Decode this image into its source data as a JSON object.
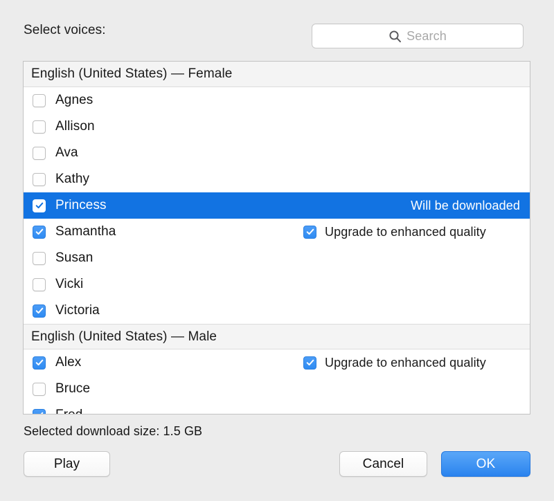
{
  "dialog": {
    "prompt_label": "Select voices:",
    "size_text": "Selected download size: 1.5 GB"
  },
  "search": {
    "icon": "search-icon",
    "placeholder": "Search",
    "value": ""
  },
  "groups": [
    {
      "header": "English (United States) — Female",
      "rows": [
        {
          "name": "Agnes",
          "checked": false,
          "selected": false,
          "status": "",
          "upgrade": null
        },
        {
          "name": "Allison",
          "checked": false,
          "selected": false,
          "status": "",
          "upgrade": null
        },
        {
          "name": "Ava",
          "checked": false,
          "selected": false,
          "status": "",
          "upgrade": null
        },
        {
          "name": "Kathy",
          "checked": false,
          "selected": false,
          "status": "",
          "upgrade": null
        },
        {
          "name": "Princess",
          "checked": true,
          "selected": true,
          "status": "Will be downloaded",
          "upgrade": null
        },
        {
          "name": "Samantha",
          "checked": true,
          "selected": false,
          "status": "",
          "upgrade": {
            "label": "Upgrade to enhanced quality",
            "checked": true
          }
        },
        {
          "name": "Susan",
          "checked": false,
          "selected": false,
          "status": "",
          "upgrade": null
        },
        {
          "name": "Vicki",
          "checked": false,
          "selected": false,
          "status": "",
          "upgrade": null
        },
        {
          "name": "Victoria",
          "checked": true,
          "selected": false,
          "status": "",
          "upgrade": null
        }
      ]
    },
    {
      "header": "English (United States) — Male",
      "rows": [
        {
          "name": "Alex",
          "checked": true,
          "selected": false,
          "status": "",
          "upgrade": {
            "label": "Upgrade to enhanced quality",
            "checked": true
          }
        },
        {
          "name": "Bruce",
          "checked": false,
          "selected": false,
          "status": "",
          "upgrade": null
        },
        {
          "name": "Fred",
          "checked": true,
          "selected": false,
          "status": "",
          "upgrade": null,
          "clipped": true
        }
      ]
    }
  ],
  "buttons": {
    "play": "Play",
    "cancel": "Cancel",
    "ok": "OK"
  },
  "colors": {
    "selection_blue": "#1273e2",
    "checkbox_blue": "#3d94f6",
    "default_button_blue": "#2a83ee",
    "window_background": "#ececec",
    "list_background": "#ffffff",
    "group_header_background": "#f4f4f4"
  }
}
